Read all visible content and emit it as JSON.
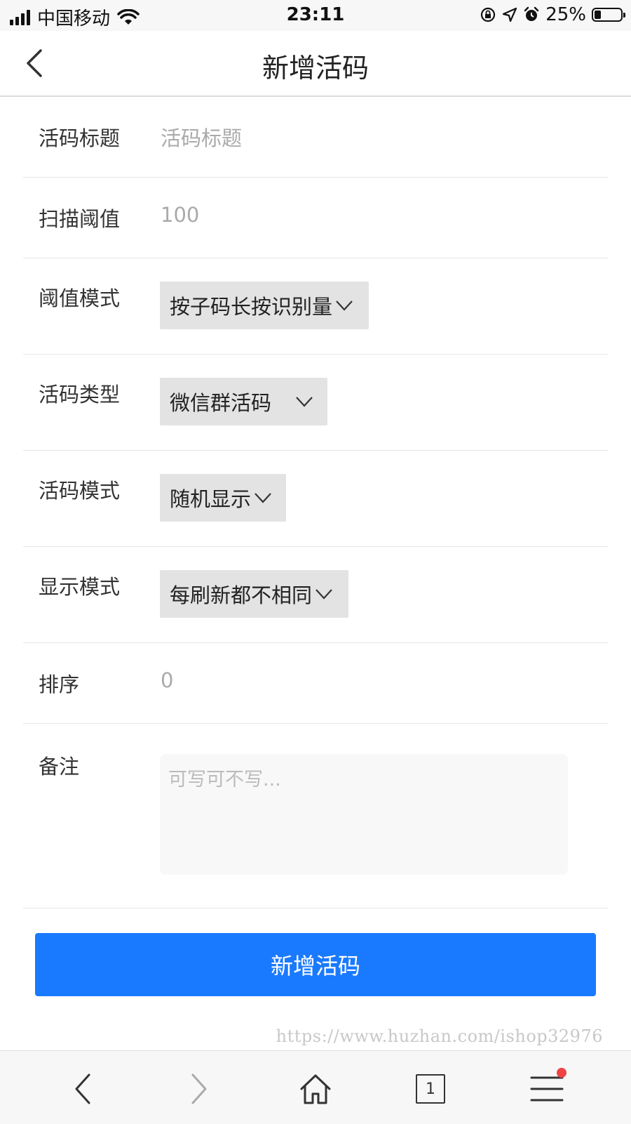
{
  "status_bar": {
    "carrier": "中国移动",
    "time": "23:11",
    "battery_text": "25%",
    "battery_level": 0.25
  },
  "nav": {
    "title": "新增活码"
  },
  "form": {
    "title_row": {
      "label": "活码标题",
      "placeholder": "活码标题"
    },
    "threshold_row": {
      "label": "扫描阈值",
      "value": "100"
    },
    "threshold_mode_row": {
      "label": "阈值模式",
      "value": "按子码长按识别量"
    },
    "code_type_row": {
      "label": "活码类型",
      "value": "微信群活码"
    },
    "code_mode_row": {
      "label": "活码模式",
      "value": "随机显示"
    },
    "display_mode_row": {
      "label": "显示模式",
      "value": "每刷新都不相同"
    },
    "sort_row": {
      "label": "排序",
      "value": "0"
    },
    "note_row": {
      "label": "备注",
      "placeholder": "可写可不写..."
    }
  },
  "submit_label": "新增活码",
  "watermark": "https://www.huzhan.com/ishop32976",
  "bottom_bar": {
    "tab_count": "1"
  },
  "colors": {
    "accent": "#1a7aff",
    "select_bg": "#e3e3e3",
    "notification_dot": "#ee4444"
  },
  "icons": [
    "back-chevron-icon",
    "forward-chevron-icon",
    "home-icon",
    "tabs-icon",
    "menu-icon",
    "wifi-icon",
    "location-icon",
    "alarm-icon",
    "rotation-lock-icon"
  ]
}
